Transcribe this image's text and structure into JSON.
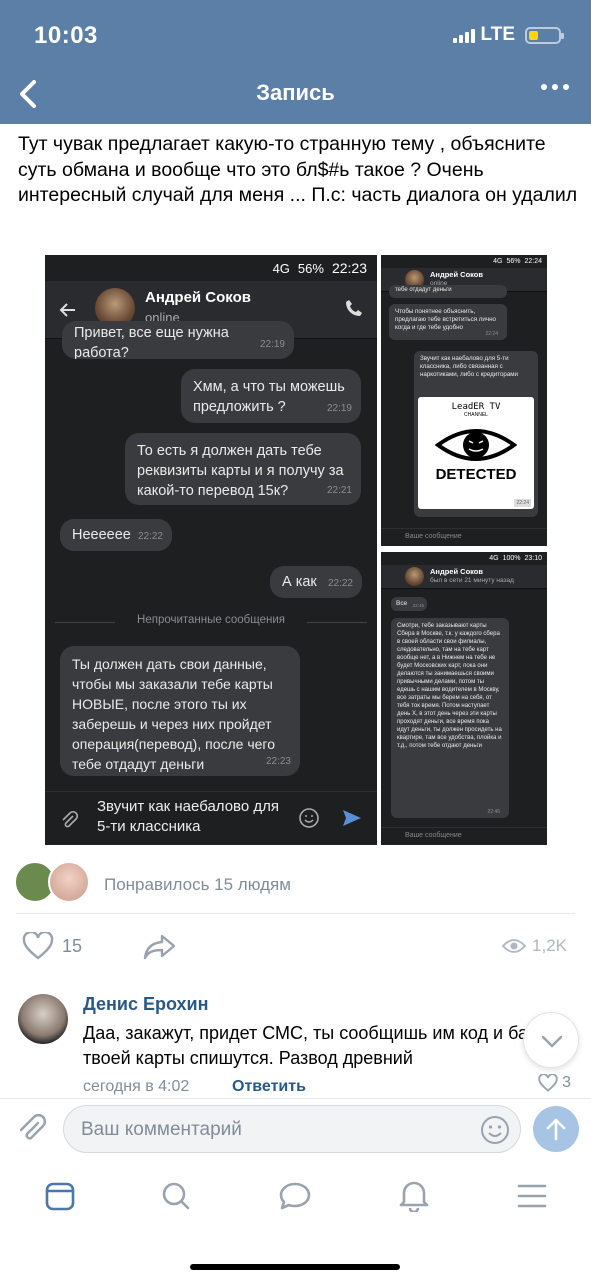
{
  "status_bar": {
    "time": "10:03",
    "network": "LTE"
  },
  "nav": {
    "title": "Запись"
  },
  "post": {
    "text": "Тут чувак предлагает какую-то странную тему , объясните суть обмана и вообще что это бл$#ь такое ? Очень интересный случай для меня ... П.с: часть диалога он удалил"
  },
  "shot_main": {
    "status": {
      "network": "4G",
      "battery": "56%",
      "time": "22:23"
    },
    "contact_name": "Андрей Соков",
    "contact_status": "online",
    "messages": [
      {
        "text": "Привет, все еще нужна работа?",
        "time": "22:19"
      },
      {
        "text": "Хмм, а что ты можешь предложить ?",
        "time": "22:19"
      },
      {
        "text": "То есть я должен дать тебе реквизиты карты и я получу за какой-то перевод 15к?",
        "time": "22:21"
      },
      {
        "text": "Нееееее",
        "time": "22:22"
      },
      {
        "text": "А как",
        "time": "22:22"
      },
      {
        "text": "Ты должен дать свои данные, чтобы мы заказали тебе карты НОВЫЕ, после этого ты их заберешь и через них пройдет операция(перевод), после чего тебе отдадут деньги",
        "time": "22:23"
      }
    ],
    "unread_divider": "Непрочитанные сообщения",
    "input_text": "Звучит как наебалово для  5-ти классника"
  },
  "shot_top_right": {
    "status": {
      "network": "4G",
      "battery": "56%",
      "time": "22:24"
    },
    "contact_name": "Андрей Соков",
    "contact_status": "online",
    "messages": [
      {
        "text": "тебе отдадут деньги",
        "time": "22:23"
      },
      {
        "text": "Чтобы понятнее объяснить, предлагаю тебе встретиться лично когда и где тебе удобно",
        "time": "22:24"
      },
      {
        "text": "Звучит как наебалово для  5-ти классника, либо связанная с наркотиками, либо с кредиторами",
        "time": ""
      }
    ],
    "meme": {
      "line1": "LeadER TV",
      "line2": "CHANNEL",
      "caption": "DETECTED"
    },
    "meme_time": "22:24",
    "input_placeholder": "Ваше сообщение"
  },
  "shot_bottom_right": {
    "status": {
      "network": "4G",
      "battery": "100%",
      "time": "23:10"
    },
    "contact_name": "Андрей Соков",
    "contact_status": "был в сети 21 минуту назад",
    "messages": [
      {
        "text": "Все",
        "time": "22:45"
      },
      {
        "text": "Смотри, тебе заказывают карты Сбера в Москве, т.к. у каждого сбера в своей области свои филиалы, следовательно, там на тебе карт вообще нет, а в Нижнем на тебе не будет Московских карт, пока они делаются ты занимаешься своими привычными делами, потом ты едешь с нашим водителем в Москву, все затраты мы берем на себя, от тебя ток время. Потом наступает день Х, в этот день через эти карты проходят деньги, все время пока идут деньги, ты должен просидеть на квартире, там все удобства, плойка и т.д., потом тебе отдают деньги",
        "time": "22:46"
      }
    ],
    "input_placeholder": "Ваше сообщение"
  },
  "likes": {
    "text": "Понравилось 15 людям",
    "count": "15",
    "views": "1,2K"
  },
  "comment": {
    "author": "Денис Ерохин",
    "text": "Даа, закажут, придет СМС, ты сообщишь им код и бабки с твоей карты спишутся. Развод древний",
    "time": "сегодня в 4:02",
    "reply": "Ответить",
    "likes": "3"
  },
  "composer": {
    "placeholder": "Ваш комментарий"
  },
  "colors": {
    "header": "#5b7fa6",
    "link": "#2a5885",
    "accent": "#4a76a8"
  }
}
